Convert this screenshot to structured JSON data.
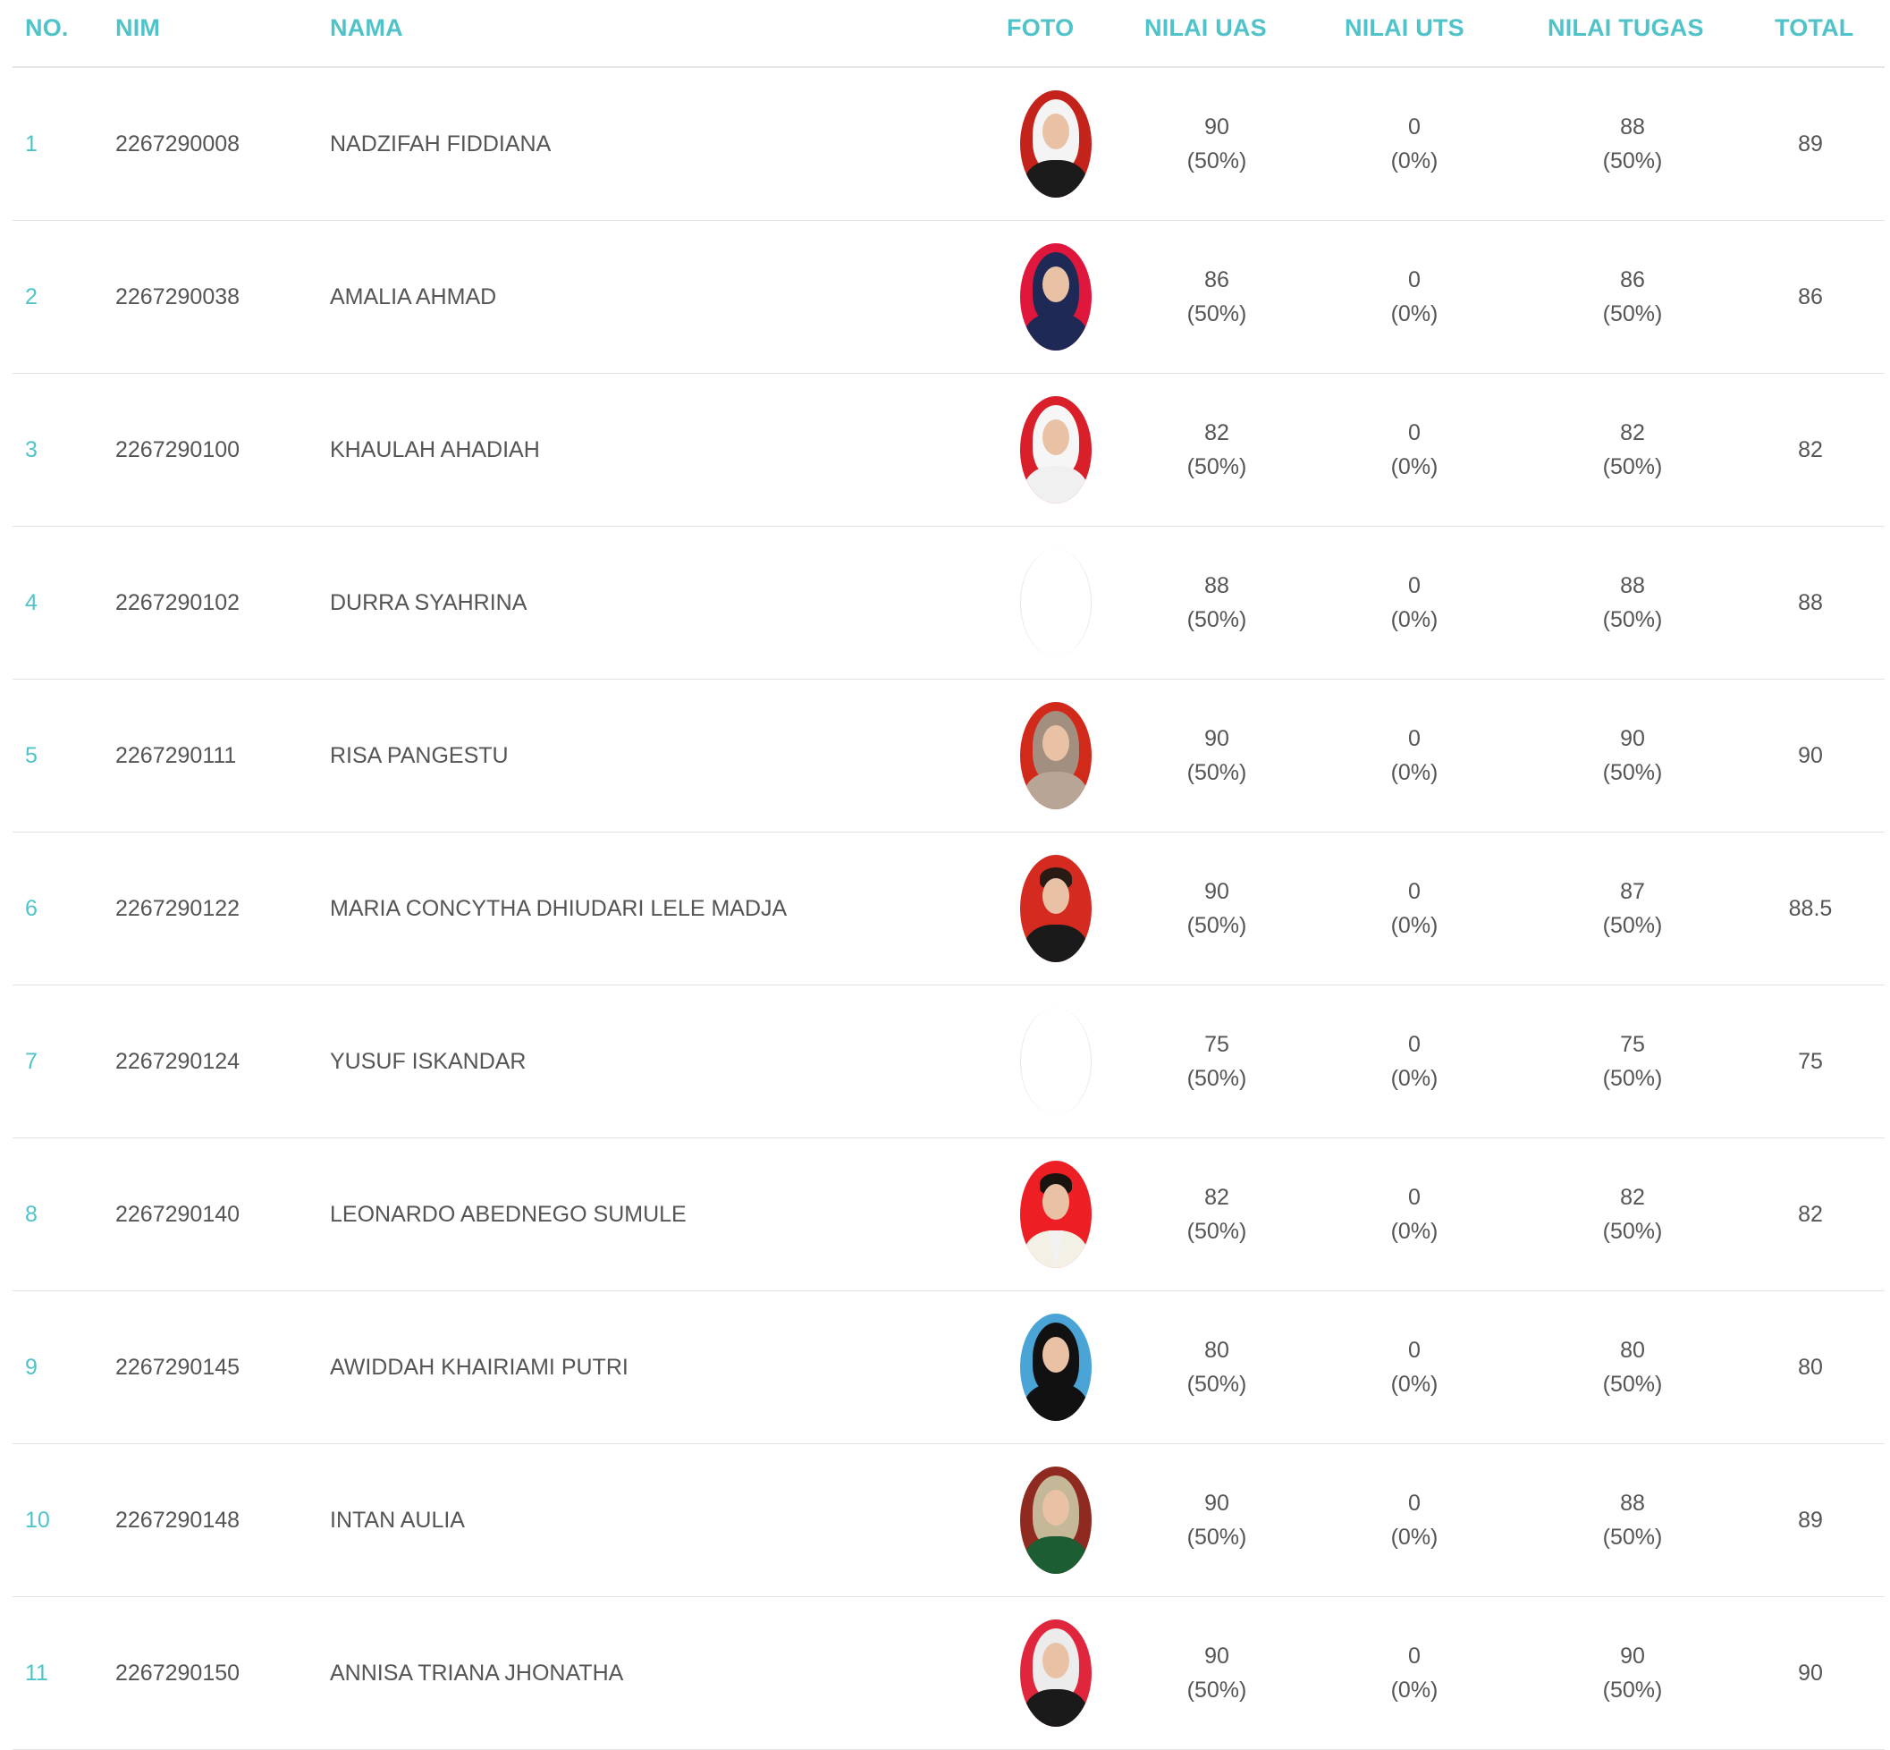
{
  "header": {
    "no": "NO.",
    "nim": "NIM",
    "nama": "NAMA",
    "foto": "FOTO",
    "nilai_uas": "NILAI UAS",
    "nilai_uts": "NILAI UTS",
    "nilai_tugas": "NILAI TUGAS",
    "total": "TOTAL"
  },
  "colors": {
    "accent": "#4fc3c9",
    "text": "#555555",
    "divider": "#e3e3e3"
  },
  "rows": [
    {
      "no": "1",
      "nim": "2267290008",
      "nama": "NADZIFAH FIDDIANA",
      "photo": "student-photo",
      "uas": "90",
      "uas_pct": "(50%)",
      "uts": "0",
      "uts_pct": "(0%)",
      "tugas": "88",
      "tugas_pct": "(50%)",
      "total": "89"
    },
    {
      "no": "2",
      "nim": "2267290038",
      "nama": "AMALIA AHMAD",
      "photo": "student-photo",
      "uas": "86",
      "uas_pct": "(50%)",
      "uts": "0",
      "uts_pct": "(0%)",
      "tugas": "86",
      "tugas_pct": "(50%)",
      "total": "86"
    },
    {
      "no": "3",
      "nim": "2267290100",
      "nama": "KHAULAH AHADIAH",
      "photo": "student-photo",
      "uas": "82",
      "uas_pct": "(50%)",
      "uts": "0",
      "uts_pct": "(0%)",
      "tugas": "82",
      "tugas_pct": "(50%)",
      "total": "82"
    },
    {
      "no": "4",
      "nim": "2267290102",
      "nama": "DURRA SYAHRINA",
      "photo": "empty-photo-placeholder",
      "uas": "88",
      "uas_pct": "(50%)",
      "uts": "0",
      "uts_pct": "(0%)",
      "tugas": "88",
      "tugas_pct": "(50%)",
      "total": "88"
    },
    {
      "no": "5",
      "nim": "2267290111",
      "nama": "RISA PANGESTU",
      "photo": "student-photo",
      "uas": "90",
      "uas_pct": "(50%)",
      "uts": "0",
      "uts_pct": "(0%)",
      "tugas": "90",
      "tugas_pct": "(50%)",
      "total": "90"
    },
    {
      "no": "6",
      "nim": "2267290122",
      "nama": "MARIA CONCYTHA DHIUDARI LELE MADJA",
      "photo": "student-photo",
      "uas": "90",
      "uas_pct": "(50%)",
      "uts": "0",
      "uts_pct": "(0%)",
      "tugas": "87",
      "tugas_pct": "(50%)",
      "total": "88.5"
    },
    {
      "no": "7",
      "nim": "2267290124",
      "nama": "YUSUF ISKANDAR",
      "photo": "empty-photo-placeholder",
      "uas": "75",
      "uas_pct": "(50%)",
      "uts": "0",
      "uts_pct": "(0%)",
      "tugas": "75",
      "tugas_pct": "(50%)",
      "total": "75"
    },
    {
      "no": "8",
      "nim": "2267290140",
      "nama": "LEONARDO ABEDNEGO SUMULE",
      "photo": "student-photo",
      "uas": "82",
      "uas_pct": "(50%)",
      "uts": "0",
      "uts_pct": "(0%)",
      "tugas": "82",
      "tugas_pct": "(50%)",
      "total": "82"
    },
    {
      "no": "9",
      "nim": "2267290145",
      "nama": "AWIDDAH KHAIRIAMI PUTRI",
      "photo": "student-photo",
      "uas": "80",
      "uas_pct": "(50%)",
      "uts": "0",
      "uts_pct": "(0%)",
      "tugas": "80",
      "tugas_pct": "(50%)",
      "total": "80"
    },
    {
      "no": "10",
      "nim": "2267290148",
      "nama": "INTAN AULIA",
      "photo": "student-photo",
      "uas": "90",
      "uas_pct": "(50%)",
      "uts": "0",
      "uts_pct": "(0%)",
      "tugas": "88",
      "tugas_pct": "(50%)",
      "total": "89"
    },
    {
      "no": "11",
      "nim": "2267290150",
      "nama": "ANNISA TRIANA JHONATHA",
      "photo": "student-photo",
      "uas": "90",
      "uas_pct": "(50%)",
      "uts": "0",
      "uts_pct": "(0%)",
      "tugas": "90",
      "tugas_pct": "(50%)",
      "total": "90"
    }
  ]
}
